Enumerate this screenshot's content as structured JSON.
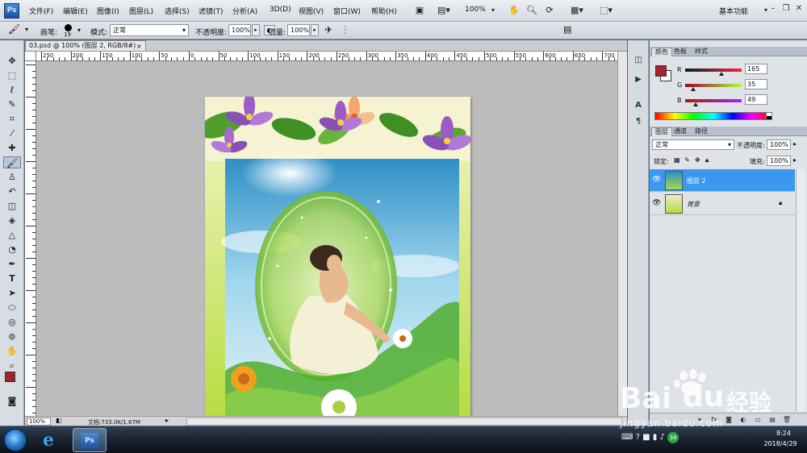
{
  "app": {
    "logo": "Ps"
  },
  "menu": [
    "文件(F)",
    "编辑(E)",
    "图像(I)",
    "图层(L)",
    "选择(S)",
    "滤镜(T)",
    "分析(A)",
    "3D(D)",
    "视图(V)",
    "窗口(W)",
    "帮助(H)"
  ],
  "menubar_tools": {
    "zoom_value": "100%",
    "workspace": "基本功能"
  },
  "options": {
    "brush_label": "画笔:",
    "brush_size": "19",
    "mode_label": "模式:",
    "mode_value": "正常",
    "opacity_label": "不透明度:",
    "opacity_value": "100%",
    "flow_label": "流量:",
    "flow_value": "100%"
  },
  "document": {
    "tab_title": "03.psd @ 100% (图层 2, RGB/8#)",
    "tab_close": "×",
    "ruler_numbers": [
      "250",
      "200",
      "150",
      "100",
      "50",
      "0",
      "50",
      "100",
      "150",
      "200",
      "250",
      "300",
      "350",
      "400",
      "450",
      "500",
      "550",
      "600",
      "650",
      "700"
    ],
    "zoom": "100%",
    "doc_info": "文档:733.0K/1.67M"
  },
  "color_panel": {
    "tabs": [
      "颜色",
      "色板",
      "样式"
    ],
    "foreground": "#a5232f",
    "background": "#ffffff",
    "channels": [
      {
        "label": "R",
        "value": "165",
        "level": 0.647
      },
      {
        "label": "G",
        "value": "35",
        "level": 0.137
      },
      {
        "label": "B",
        "value": "49",
        "level": 0.192
      }
    ]
  },
  "layers_panel": {
    "tabs": [
      "图层",
      "通道",
      "路径"
    ],
    "blend_mode": "正常",
    "opacity_label": "不透明度:",
    "opacity_value": "100%",
    "lock_label": "锁定:",
    "fill_label": "填充:",
    "fill_value": "100%",
    "layers": [
      {
        "name": "图层 2",
        "selected": true
      },
      {
        "name": "背景",
        "selected": false,
        "locked": true
      }
    ]
  },
  "taskbar": {
    "tray_badge": "34",
    "time": "8:24",
    "date": "2018/4/29"
  },
  "watermark": {
    "brand": "Bai",
    "brand_suffix": "经验",
    "url": "jingyan.baidu.com"
  }
}
